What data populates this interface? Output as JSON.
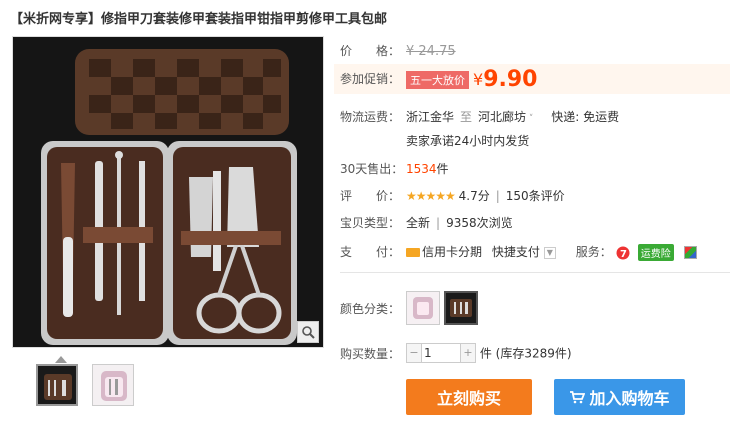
{
  "title": "【米折网专享】修指甲刀套装修甲套装指甲钳指甲剪修甲工具包邮",
  "price": {
    "label": "价　　格：",
    "original": "¥ 24.75"
  },
  "promo": {
    "label": "参加促销：",
    "tag": "五一大放价",
    "yen": "¥",
    "price": "9.90"
  },
  "logistics": {
    "label": "物流运费：",
    "from": "浙江金华",
    "sep": "至",
    "to": "河北廊坊",
    "shipping": "快递: 免运费",
    "promise": "卖家承诺24小时内发货"
  },
  "sales": {
    "label": "30天售出：",
    "count": "1534",
    "unit": "件"
  },
  "rating": {
    "label": "评　　价：",
    "stars": "★★★★★",
    "score": "4.7分",
    "reviews": "150条评价"
  },
  "type": {
    "label": "宝贝类型：",
    "condition": "全新",
    "views": "9358次浏览"
  },
  "payment": {
    "label": "支　　付：",
    "method1": "信用卡分期",
    "method2": "快捷支付",
    "service_label": "服务：",
    "badge": "运费险"
  },
  "color": {
    "label": "颜色分类："
  },
  "quantity": {
    "label": "购买数量：",
    "value": "1",
    "minus": "−",
    "plus": "+",
    "stock": "件 (库存3289件)"
  },
  "buttons": {
    "buy": "立刻购买",
    "cart": "加入购物车"
  },
  "colors": {
    "accent": "#f40",
    "buy_btn": "#f37b1d",
    "cart_btn": "#3a97e8",
    "promo_tag": "#ee6a66"
  }
}
